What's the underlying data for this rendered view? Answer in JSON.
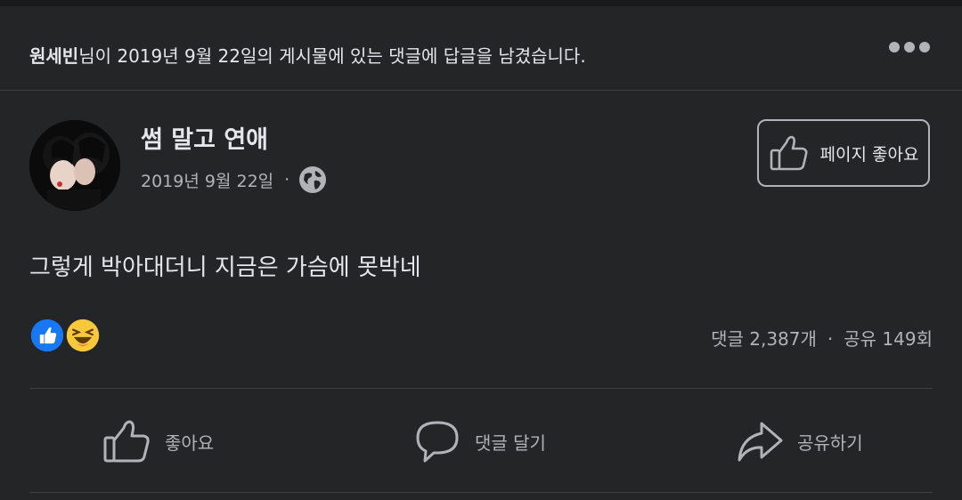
{
  "notice": {
    "user_name": "원세빈",
    "text": "님이 2019년 9월 22일의 게시물에 있는 댓글에 답글을 남겼습니다."
  },
  "post": {
    "page_name": "썸 말고 연애",
    "date": "2019년 9월 22일",
    "separator": "·",
    "privacy_icon": "globe-icon",
    "body": "그렇게 박아대더니 지금은 가슴에 못박네"
  },
  "like_page_button": {
    "label": "페이지 좋아요",
    "icon": "thumbs-up-icon"
  },
  "reactions": [
    "like-reaction-icon",
    "haha-reaction-icon"
  ],
  "stats": {
    "comments": "댓글 2,387개",
    "separator": "·",
    "shares": "공유 149회"
  },
  "actions": {
    "like": "좋아요",
    "comment": "댓글 달기",
    "share": "공유하기"
  },
  "colors": {
    "background": "#242526",
    "text_primary": "#e4e6eb",
    "text_secondary": "#b0b3b8",
    "like_blue": "#1877f2",
    "haha_yellow": "#f7c83c"
  }
}
